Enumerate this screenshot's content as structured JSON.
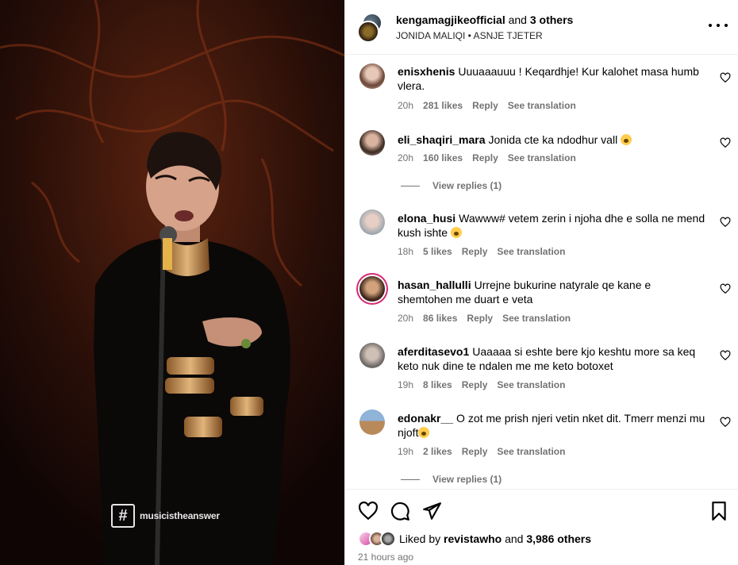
{
  "header": {
    "account": "kengamagjikeofficial",
    "and_text": "and",
    "others": "3 others",
    "subtitle": "JONIDA MALIQI • ASNJE TJETER"
  },
  "media": {
    "watermark_symbol": "#",
    "watermark_text": "musicistheanswer"
  },
  "comments": [
    {
      "user": "enisxhenis",
      "text": "Uuuaaauuu ! Keqardhje! Kur kalohet masa humb vlera.",
      "time": "20h",
      "likes": "281 likes",
      "reply": "Reply",
      "translate": "See translation"
    },
    {
      "user": "eli_shaqiri_mara",
      "text": "Jonida cte ka ndodhur vall",
      "emoji": "astonished-face",
      "time": "20h",
      "likes": "160 likes",
      "reply": "Reply",
      "translate": "See translation",
      "view_replies": "View replies (1)"
    },
    {
      "user": "elona_husi",
      "text": "Wawww# vetem zerin i njoha dhe e solla ne mend kush ishte",
      "emoji": "flushed-face",
      "time": "18h",
      "likes": "5 likes",
      "reply": "Reply",
      "translate": "See translation"
    },
    {
      "user": "hasan_hallulli",
      "text": "Urrejne bukurine natyrale qe kane e shemtohen me duart e veta",
      "time": "20h",
      "likes": "86 likes",
      "reply": "Reply",
      "translate": "See translation"
    },
    {
      "user": "aferditasevo1",
      "text": "Uaaaaa si eshte bere kjo keshtu more sa keq keto nuk dine te ndalen me me keto botoxet",
      "time": "19h",
      "likes": "8 likes",
      "reply": "Reply",
      "translate": "See translation"
    },
    {
      "user": "edonakr__",
      "text": "O zot me prish njeri vetin nket dit. Tmerr menzi mu njoft",
      "emoji": "astonished-face",
      "time": "19h",
      "likes": "2 likes",
      "reply": "Reply",
      "translate": "See translation",
      "view_replies": "View replies (1)"
    }
  ],
  "footer": {
    "liked_by": "Liked by",
    "liker": "revistawho",
    "and_text": "and",
    "others": "3,986 others",
    "time_ago": "21 hours ago"
  },
  "icons": {
    "like": "heart-icon",
    "comment": "comment-icon",
    "share": "share-icon",
    "save": "bookmark-icon",
    "more": "more-options-icon"
  }
}
